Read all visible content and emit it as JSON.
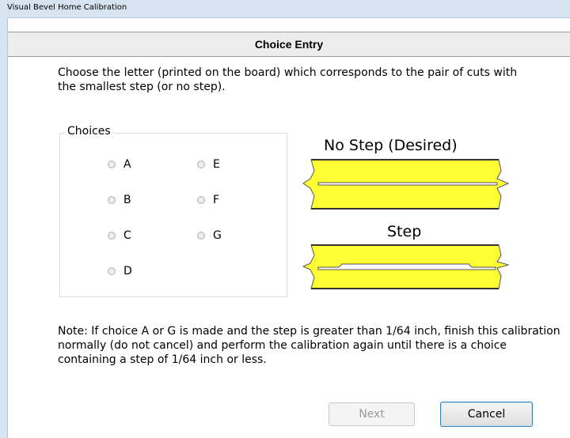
{
  "window": {
    "title": "Visual Bevel Home Calibration"
  },
  "header": {
    "title": "Choice Entry"
  },
  "instructions": "Choose the letter (printed on the board) which corresponds to the pair of cuts with the smallest step (or no step).",
  "choices": {
    "legend": "Choices",
    "options": [
      {
        "label": "A",
        "selected": false
      },
      {
        "label": "B",
        "selected": false
      },
      {
        "label": "C",
        "selected": false
      },
      {
        "label": "D",
        "selected": false
      },
      {
        "label": "E",
        "selected": false
      },
      {
        "label": "F",
        "selected": false
      },
      {
        "label": "G",
        "selected": false
      }
    ]
  },
  "diagrams": {
    "no_step_label": "No Step (Desired)",
    "step_label": "Step",
    "board_color": "#ffff33"
  },
  "note": "Note:  If choice A or G is made and the step is greater than 1/64 inch, finish this calibration normally (do not cancel) and perform the calibration again until there is a choice containing a step of 1/64 inch or less.",
  "buttons": {
    "next_label": "Next",
    "next_enabled": false,
    "cancel_label": "Cancel"
  }
}
